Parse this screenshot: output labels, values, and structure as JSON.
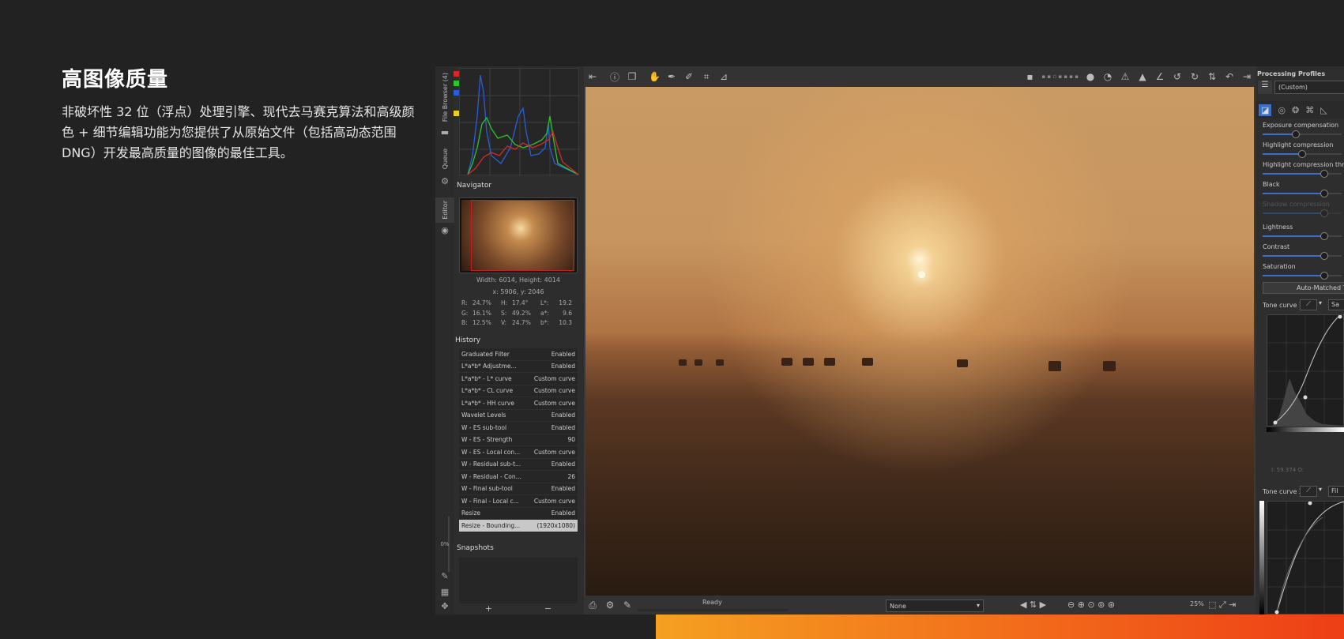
{
  "hero": {
    "title": "高图像质量",
    "description": "非破坏性 32 位（浮点）处理引擎、现代去马赛克算法和高级颜色 + 细节编辑功能为您提供了从原始文件（包括高动态范围 DNG）开发最高质量的图像的最佳工具。"
  },
  "vertical_tabs": {
    "file_browser": "File Browser (4)",
    "queue": "Queue",
    "editor": "Editor",
    "progress": "0%"
  },
  "navigator": {
    "title": "Navigator",
    "dimensions": "Width: 6014, Height: 4014",
    "coords": "x: 5906, y: 2046",
    "rows": [
      [
        "R:",
        "24.7%",
        "H:",
        "17.4°",
        "L*:",
        "19.2"
      ],
      [
        "G:",
        "16.1%",
        "S:",
        "49.2%",
        "a*:",
        "9.6"
      ],
      [
        "B:",
        "12.5%",
        "V:",
        "24.7%",
        "b*:",
        "10.3"
      ]
    ]
  },
  "history": {
    "title": "History",
    "items": [
      {
        "name": "Graduated Filter",
        "value": "Enabled"
      },
      {
        "name": "L*a*b* Adjustme...",
        "value": "Enabled"
      },
      {
        "name": "L*a*b* - L* curve",
        "value": "Custom curve"
      },
      {
        "name": "L*a*b* - CL curve",
        "value": "Custom curve"
      },
      {
        "name": "L*a*b* - HH curve",
        "value": "Custom curve"
      },
      {
        "name": "Wavelet Levels",
        "value": "Enabled"
      },
      {
        "name": "W - ES sub-tool",
        "value": "Enabled"
      },
      {
        "name": "W - ES - Strength",
        "value": "90"
      },
      {
        "name": "W - ES - Local con...",
        "value": "Custom curve"
      },
      {
        "name": "W - Residual sub-t...",
        "value": "Enabled"
      },
      {
        "name": "W - Residual - Con...",
        "value": "26"
      },
      {
        "name": "W - Final sub-tool",
        "value": "Enabled"
      },
      {
        "name": "W - Final - Local c...",
        "value": "Custom curve"
      },
      {
        "name": "Resize",
        "value": "Enabled"
      },
      {
        "name": "Resize - Bounding...",
        "value": "(1920x1080)"
      }
    ]
  },
  "snapshots": {
    "title": "Snapshots",
    "add": "+",
    "remove": "−"
  },
  "status": {
    "text": "Ready",
    "select_value": "None",
    "zoom": "25%"
  },
  "right_panel": {
    "title": "Processing Profiles",
    "profile": "(Custom)",
    "sliders": [
      {
        "label": "Exposure compensation",
        "level": 0.42
      },
      {
        "label": "Highlight compression",
        "level": 0.5
      },
      {
        "label": "Highlight compression thresh",
        "level": 0.78
      },
      {
        "label": "Black",
        "level": 0.78
      },
      {
        "label": "Shadow compression",
        "level": 0.78
      },
      {
        "label": "Lightness",
        "level": 0.78
      },
      {
        "label": "Contrast",
        "level": 0.78
      },
      {
        "label": "Saturation",
        "level": 0.78
      }
    ],
    "auto_button": "Auto-Matched To",
    "tone_curve_1": "Tone curve 1:",
    "tone_curve_1_mode": "Sa",
    "tone_curve_2": "Tone curve 2:",
    "tone_curve_2_mode": "Fil",
    "curve_inputs": "I:  59.374    O:"
  },
  "colors": {
    "accent": "#3c6ec8",
    "promo_start": "#f5a021",
    "promo_end": "#ee3e16"
  }
}
